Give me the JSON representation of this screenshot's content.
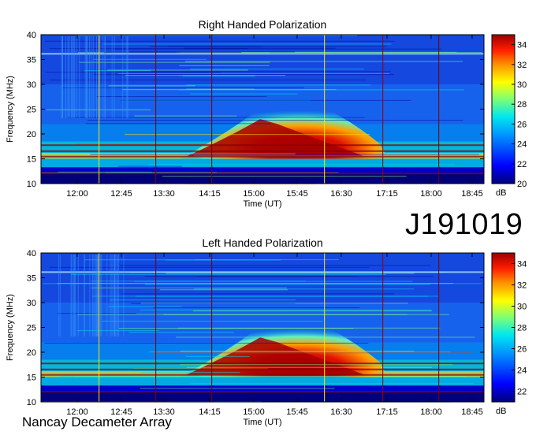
{
  "footer": {
    "station": "Nancay Decameter Array",
    "identifier": "J191019"
  },
  "chart_data": [
    {
      "type": "heatmap",
      "title": "Right Handed Polarization",
      "xlabel": "Time (UT)",
      "ylabel": "Frequency (MHz)",
      "x_ticks": [
        "12:00",
        "12:45",
        "13:30",
        "14:15",
        "15:00",
        "15:45",
        "16:30",
        "17:15",
        "18:00",
        "18:45"
      ],
      "y_ticks": [
        10,
        15,
        20,
        25,
        30,
        35,
        40
      ],
      "ylim": [
        10,
        40
      ],
      "colorbar": {
        "label": "dB",
        "ticks": [
          20,
          22,
          24,
          26,
          28,
          30,
          32,
          34
        ],
        "range": [
          20,
          35
        ]
      }
    },
    {
      "type": "heatmap",
      "title": "Left Handed Polarization",
      "xlabel": "Time (UT)",
      "ylabel": "Frequency (MHz)",
      "x_ticks": [
        "12:00",
        "12:45",
        "13:30",
        "14:15",
        "15:00",
        "15:45",
        "16:30",
        "17:15",
        "18:00",
        "18:45"
      ],
      "y_ticks": [
        10,
        15,
        20,
        25,
        30,
        35,
        40
      ],
      "ylim": [
        10,
        40
      ],
      "colorbar": {
        "label": "dB",
        "ticks": [
          22,
          24,
          26,
          28,
          30,
          32,
          34
        ],
        "range": [
          21,
          35
        ]
      }
    }
  ],
  "colors": {
    "low": "#00007a",
    "mid": "#00c8e0",
    "high": "#a00000"
  }
}
